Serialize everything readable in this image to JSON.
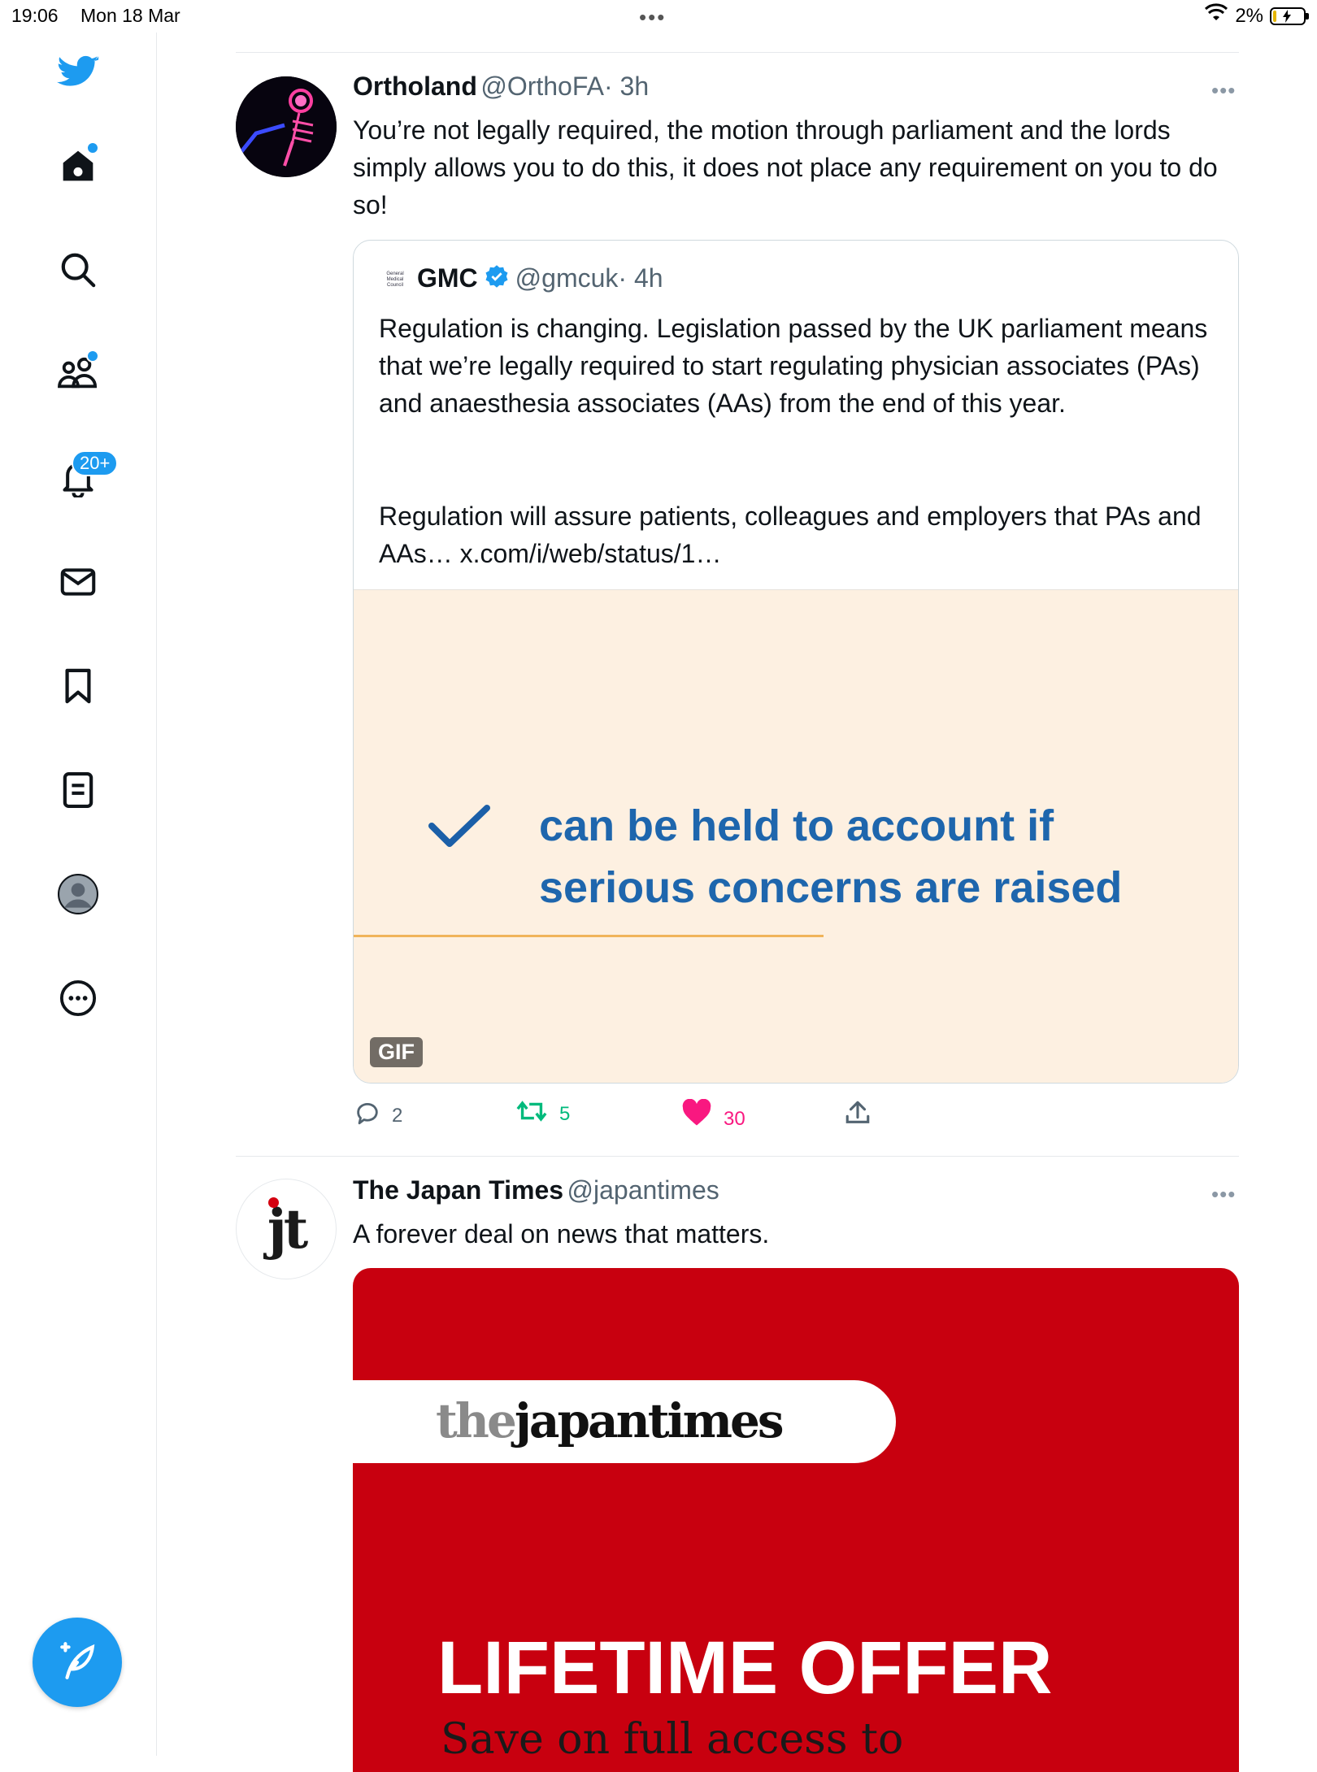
{
  "status_bar": {
    "time": "19:06",
    "date": "Mon 18 Mar",
    "battery": "2%",
    "dots": "•••"
  },
  "sidebar": {
    "items": [
      {
        "icon": "bird-logo-icon"
      },
      {
        "icon": "home-icon"
      },
      {
        "icon": "search-icon"
      },
      {
        "icon": "communities-icon"
      },
      {
        "icon": "bell-icon",
        "badge": "20+"
      },
      {
        "icon": "mail-icon"
      },
      {
        "icon": "bookmark-icon"
      },
      {
        "icon": "lists-icon"
      },
      {
        "icon": "profile-avatar-icon"
      },
      {
        "icon": "more-circle-icon"
      }
    ],
    "compose_icon": "compose-feather-icon"
  },
  "tweets": [
    {
      "name": "Ortholand",
      "handle": "@OrthoFA",
      "time": "· 3h",
      "more": "•••",
      "text": "You’re not legally required, the motion through parliament and the lords simply allows you to do this, it does not place any requirement on you to do so!",
      "quote": {
        "logo_text": "General Medical Council",
        "name": "GMC",
        "handle": "@gmcuk",
        "time": "· 4h",
        "text_p1": "Regulation is changing. Legislation passed by the UK parliament means that we’re legally required to start regulating physician associates (PAs) and anaesthesia associates (AAs) from the end of this year.",
        "text_p2": "Regulation will assure patients, colleagues and employers that PAs and AAs… x.com/i/web/status/1…",
        "media_line1": "can be held to account if",
        "media_line2": "serious concerns are raised",
        "media_badge": "GIF"
      },
      "actions": {
        "replies": "2",
        "retweets": "5",
        "likes": "30"
      }
    },
    {
      "name": "The Japan Times",
      "handle": "@japantimes",
      "more": "•••",
      "avatar_text": "jt",
      "text": "A forever deal on news that matters.",
      "ad": {
        "logo_light": "the",
        "logo_dark": "japan",
        "logo_end": "times",
        "headline": "LIFETIME OFFER",
        "subline": "Save on full access to"
      }
    }
  ],
  "colors": {
    "accent": "#1d9bf0",
    "like": "#f91880",
    "retweet": "#00ba7c",
    "ad_red": "#c8000f",
    "gif_bg": "#fdf0e1"
  }
}
